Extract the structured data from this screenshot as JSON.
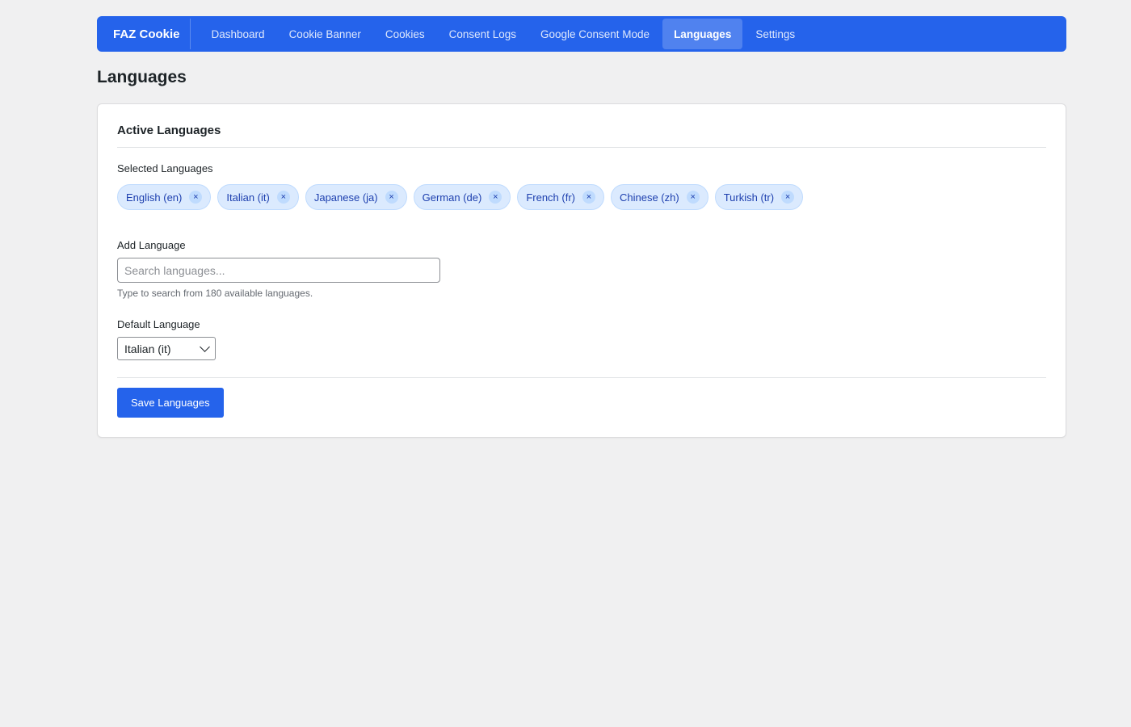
{
  "nav": {
    "brand": "FAZ Cookie",
    "items": [
      {
        "label": "Dashboard"
      },
      {
        "label": "Cookie Banner"
      },
      {
        "label": "Cookies"
      },
      {
        "label": "Consent Logs"
      },
      {
        "label": "Google Consent Mode"
      },
      {
        "label": "Languages"
      },
      {
        "label": "Settings"
      }
    ],
    "active": "Languages"
  },
  "page": {
    "title": "Languages"
  },
  "card": {
    "title": "Active Languages",
    "selected_label": "Selected Languages",
    "selected": [
      {
        "label": "English (en)"
      },
      {
        "label": "Italian (it)"
      },
      {
        "label": "Japanese (ja)"
      },
      {
        "label": "German (de)"
      },
      {
        "label": "French (fr)"
      },
      {
        "label": "Chinese (zh)"
      },
      {
        "label": "Turkish (tr)"
      }
    ],
    "remove_glyph": "×",
    "add_label": "Add Language",
    "search_placeholder": "Search languages...",
    "search_value": "",
    "hint": "Type to search from 180 available languages.",
    "default_label": "Default Language",
    "default_value": "Italian (it)",
    "save_label": "Save Languages"
  },
  "colors": {
    "brand": "#2563eb",
    "chip_bg": "#dbeafe",
    "chip_text": "#1e40af"
  }
}
